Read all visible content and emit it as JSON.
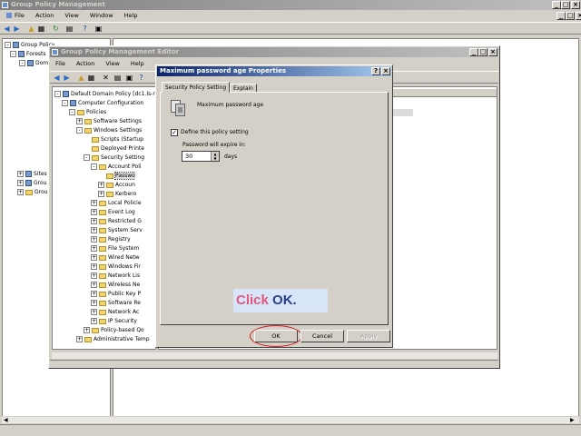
{
  "gpm": {
    "title": "Group Policy Management",
    "menu": [
      "File",
      "Action",
      "View",
      "Window",
      "Help"
    ],
    "tree": [
      {
        "label": "Group Policy",
        "indent": 0
      },
      {
        "label": "Forests",
        "indent": 1
      },
      {
        "label": "Dom",
        "indent": 2
      },
      {
        "label": "Sites",
        "indent": 1
      },
      {
        "label": "Grou",
        "indent": 1
      },
      {
        "label": "Grou",
        "indent": 1
      }
    ]
  },
  "editor": {
    "title": "Group Policy Management Editor",
    "menu": [
      "File",
      "Action",
      "View",
      "Help"
    ],
    "tree": [
      {
        "label": "Default Domain Policy [dc1.ls-n",
        "level": 0
      },
      {
        "label": "Computer Configuration",
        "level": 1
      },
      {
        "label": "Policies",
        "level": 2
      },
      {
        "label": "Software Settings",
        "level": 3
      },
      {
        "label": "Windows Settings",
        "level": 3
      },
      {
        "label": "Scripts (Startup",
        "level": 4
      },
      {
        "label": "Deployed Printe",
        "level": 4
      },
      {
        "label": "Security Setting",
        "level": 4
      },
      {
        "label": "Account Poli",
        "level": 5
      },
      {
        "label": "Passwo",
        "level": 6,
        "selected": true
      },
      {
        "label": "Accoun",
        "level": 6
      },
      {
        "label": "Kerbero",
        "level": 6
      },
      {
        "label": "Local Policie",
        "level": 5
      },
      {
        "label": "Event Log",
        "level": 5
      },
      {
        "label": "Restricted G",
        "level": 5
      },
      {
        "label": "System Serv",
        "level": 5
      },
      {
        "label": "Registry",
        "level": 5
      },
      {
        "label": "File System",
        "level": 5
      },
      {
        "label": "Wired Netw",
        "level": 5
      },
      {
        "label": "Windows Fir",
        "level": 5
      },
      {
        "label": "Network Lis",
        "level": 5
      },
      {
        "label": "Wireless Ne",
        "level": 5
      },
      {
        "label": "Public Key P",
        "level": 5
      },
      {
        "label": "Software Re",
        "level": 5
      },
      {
        "label": "Network Ac",
        "level": 5
      },
      {
        "label": "IP Security",
        "level": 5
      },
      {
        "label": "Policy-based Qo",
        "level": 4
      },
      {
        "label": "Administrative Temp",
        "level": 3
      }
    ]
  },
  "dialog": {
    "title": "Maximum password age Properties",
    "tabs": [
      "Security Policy Setting",
      "Explain"
    ],
    "policy_name": "Maximum password age",
    "define_label": "Define this policy setting",
    "define_checked": true,
    "expire_label": "Password will expire in:",
    "days_value": "30",
    "days_unit": "days",
    "ok_label": "OK",
    "cancel_label": "Cancel",
    "apply_label": "Apply"
  },
  "callout": {
    "click_word": "Click",
    "target_word": "OK",
    "period": "."
  }
}
